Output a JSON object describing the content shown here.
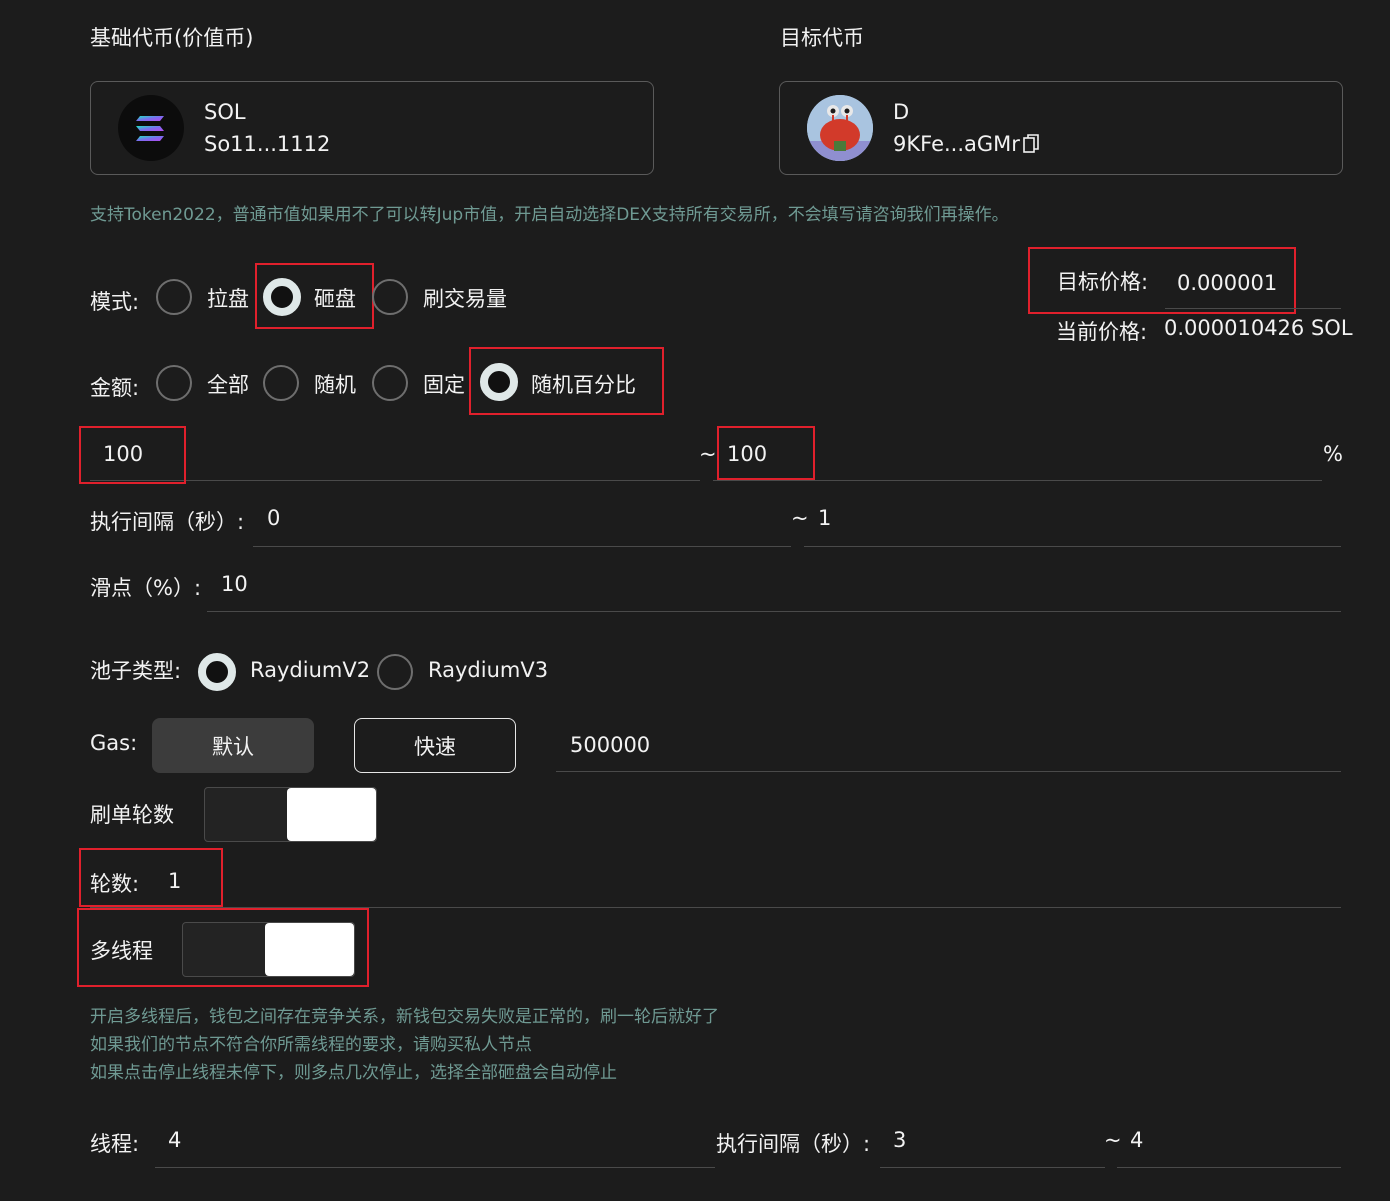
{
  "base_token": {
    "section_label": "基础代币(价值币)",
    "symbol": "SOL",
    "address": "So11...1112"
  },
  "target_token": {
    "section_label": "目标代币",
    "symbol": "D",
    "address": "9KFe...aGMr"
  },
  "support_hint": "支持Token2022，普通市值如果用不了可以转Jup市值，开启自动选择DEX支持所有交易所，不会填写请咨询我们再操作。",
  "mode": {
    "label": "模式:",
    "options": [
      "拉盘",
      "砸盘",
      "刷交易量"
    ],
    "selected": "砸盘"
  },
  "target_price": {
    "label": "目标价格:",
    "value": "0.000001"
  },
  "current_price": {
    "label": "当前价格:",
    "value": "0.000010426 SOL"
  },
  "amount": {
    "label": "金额:",
    "options": [
      "全部",
      "随机",
      "固定",
      "随机百分比"
    ],
    "selected": "随机百分比",
    "min": "100",
    "range_sep": "~",
    "max": "100",
    "unit": "%"
  },
  "exec_interval": {
    "label": "执行间隔（秒）:",
    "min": "0",
    "range_sep": "~",
    "max": "1"
  },
  "slippage": {
    "label": "滑点（%）:",
    "value": "10"
  },
  "pool_type": {
    "label": "池子类型:",
    "options": [
      "RaydiumV2",
      "RaydiumV3"
    ],
    "selected": "RaydiumV2"
  },
  "gas": {
    "label": "Gas:",
    "default_label": "默认",
    "fast_label": "快速",
    "value": "500000"
  },
  "rounds_toggle": {
    "label": "刷单轮数",
    "enabled": true
  },
  "rounds": {
    "label": "轮数:",
    "value": "1"
  },
  "multithread_toggle": {
    "label": "多线程",
    "enabled": true
  },
  "multithread_hints": [
    "开启多线程后，钱包之间存在竞争关系，新钱包交易失败是正常的，刷一轮后就好了",
    "如果我们的节点不符合你所需线程的要求，请购买私人节点",
    "如果点击停止线程未停下，则多点几次停止，选择全部砸盘会自动停止"
  ],
  "threads": {
    "label": "线程:",
    "value": "4",
    "interval_label": "执行间隔（秒）:",
    "interval_min": "3",
    "range_sep": "~",
    "interval_max": "4"
  },
  "colors": {
    "background": "#1c1c1c",
    "highlight_border": "#e0202c",
    "hint_text": "#6f9a93"
  }
}
